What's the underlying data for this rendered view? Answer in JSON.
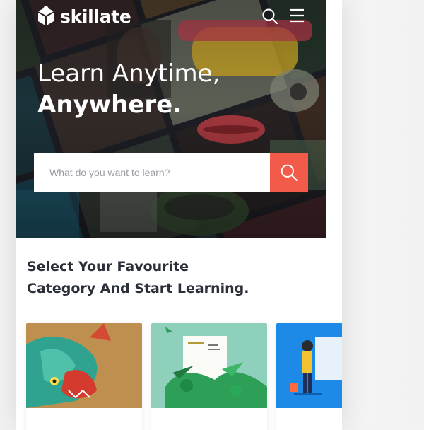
{
  "brand": {
    "name": "skillate"
  },
  "hero": {
    "headline_line1": "Learn Anytime,",
    "headline_line2": "Anywhere."
  },
  "search": {
    "placeholder": "What do you want to learn?"
  },
  "category": {
    "heading_line1": "Select Your Favourite",
    "heading_bold": "Category",
    "heading_rest": " And Start Learning."
  },
  "colors": {
    "accent": "#f25a4a",
    "heading_text": "#2b2f3a",
    "card3_bg": "#1e8ae8",
    "card2_bg": "#8fd0bd"
  },
  "icons": [
    "logo-cube-icon",
    "search-icon",
    "hamburger-menu-icon",
    "search-button-icon"
  ]
}
